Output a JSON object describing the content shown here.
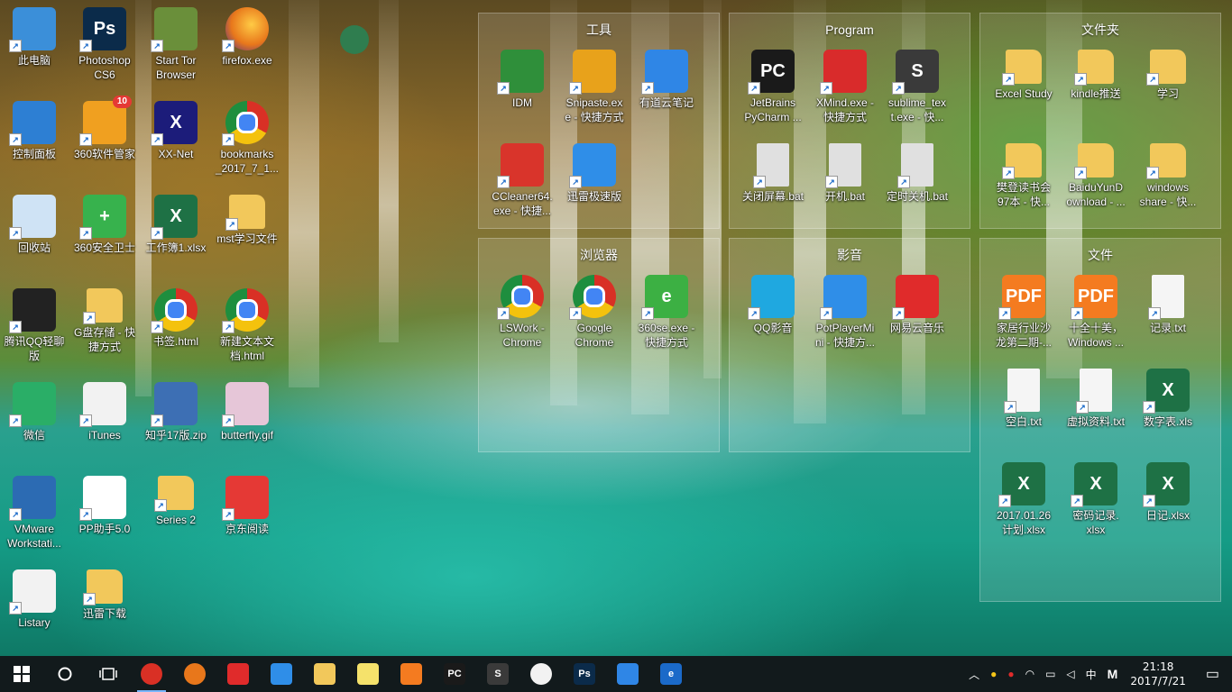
{
  "desktop_icons": [
    {
      "label": "此电脑",
      "icon": "computer-icon",
      "color": "#3b8fd9"
    },
    {
      "label": "Photoshop\nCS6",
      "icon": "photoshop-icon",
      "color": "#0b2b4a",
      "text": "Ps"
    },
    {
      "label": "Start Tor\nBrowser",
      "icon": "tor-icon",
      "color": "#6a8f3a"
    },
    {
      "label": "firefox.exe",
      "icon": "firefox-icon",
      "color": "#e8771b"
    },
    {
      "label": "控制面板",
      "icon": "control-panel-icon",
      "color": "#2d7fd3"
    },
    {
      "label": "360软件管家",
      "icon": "360-manager-icon",
      "color": "#f0a020",
      "badge": "10"
    },
    {
      "label": "XX-Net",
      "icon": "xxnet-icon",
      "color": "#1c1c7a",
      "text": "X"
    },
    {
      "label": "bookmarks\n_2017_7_1...",
      "icon": "chrome-icon",
      "color": "#d93025"
    },
    {
      "label": "回收站",
      "icon": "recycle-bin-icon",
      "color": "#cfe3f5"
    },
    {
      "label": "360安全卫士",
      "icon": "360-safe-icon",
      "color": "#37b24d",
      "text": "+"
    },
    {
      "label": "工作簿1.xlsx",
      "icon": "excel-icon",
      "color": "#1e7145",
      "text": "X"
    },
    {
      "label": "mst学习文件",
      "icon": "folder-icon",
      "color": "#f2c85b"
    },
    {
      "label": "腾讯QQ轻聊\n版",
      "icon": "qq-icon",
      "color": "#222"
    },
    {
      "label": "G盘存储 - 快\n捷方式",
      "icon": "folder-icon",
      "color": "#f2c85b"
    },
    {
      "label": "书签.html",
      "icon": "chrome-icon",
      "color": "#d93025"
    },
    {
      "label": "新建文本文\n档.html",
      "icon": "chrome-icon",
      "color": "#d93025"
    },
    {
      "label": "微信",
      "icon": "wechat-icon",
      "color": "#2aae67"
    },
    {
      "label": "iTunes",
      "icon": "itunes-icon",
      "color": "#f2f2f2"
    },
    {
      "label": "知乎17版.zip",
      "icon": "zip-icon",
      "color": "#3d6fb4"
    },
    {
      "label": "butterfly.gif",
      "icon": "gif-icon",
      "color": "#e6c6d8"
    },
    {
      "label": "VMware\nWorkstati...",
      "icon": "vmware-icon",
      "color": "#2c6bb3"
    },
    {
      "label": "PP助手5.0",
      "icon": "pp-icon",
      "color": "#ffffff",
      "text": "P"
    },
    {
      "label": "Series 2",
      "icon": "folder-icon",
      "color": "#f2c85b"
    },
    {
      "label": "京东阅读",
      "icon": "jd-read-icon",
      "color": "#e53935"
    },
    {
      "label": "Listary",
      "icon": "listary-icon",
      "color": "#f2f2f2"
    },
    {
      "label": "迅雷下载",
      "icon": "folder-icon",
      "color": "#f2c85b"
    }
  ],
  "globe_icon": {
    "icon": "globe-icon",
    "color": "#2f7d4f"
  },
  "fences": [
    {
      "title": "工具",
      "items": [
        {
          "label": "IDM",
          "icon": "idm-icon",
          "color": "#2f8f3a"
        },
        {
          "label": "Snipaste.ex\ne - 快捷方式",
          "icon": "snipaste-icon",
          "color": "#e8a21b"
        },
        {
          "label": "有道云笔记",
          "icon": "youdao-note-icon",
          "color": "#2f86e6"
        },
        {
          "label": "CCleaner64.\nexe - 快捷...",
          "icon": "ccleaner-icon",
          "color": "#d9342b"
        },
        {
          "label": "迅雷极速版",
          "icon": "xunlei-icon",
          "color": "#2f8ee8"
        }
      ]
    },
    {
      "title": "Program",
      "items": [
        {
          "label": "JetBrains\nPyCharm ...",
          "icon": "pycharm-icon",
          "color": "#1a1a1a",
          "text": "PC"
        },
        {
          "label": "XMind.exe -\n快捷方式",
          "icon": "xmind-icon",
          "color": "#d92b2b"
        },
        {
          "label": "sublime_tex\nt.exe - 快...",
          "icon": "sublime-icon",
          "color": "#3a3a3a",
          "text": "S"
        },
        {
          "label": "关闭屏幕.bat",
          "icon": "bat-icon",
          "color": "#e0e0e0"
        },
        {
          "label": "开机.bat",
          "icon": "bat-icon",
          "color": "#e0e0e0"
        },
        {
          "label": "定时关机.bat",
          "icon": "bat-icon",
          "color": "#e0e0e0"
        }
      ]
    },
    {
      "title": "文件夹",
      "items": [
        {
          "label": "Excel Study",
          "icon": "folder-icon",
          "color": "#f2c85b"
        },
        {
          "label": "kindle推送",
          "icon": "folder-icon",
          "color": "#f2c85b"
        },
        {
          "label": "学习",
          "icon": "folder-icon",
          "color": "#f2c85b"
        },
        {
          "label": "樊登读书会\n97本 - 快...",
          "icon": "folder-icon",
          "color": "#f2c85b"
        },
        {
          "label": "BaiduYunD\nownload - ...",
          "icon": "folder-icon",
          "color": "#f2c85b"
        },
        {
          "label": "windows\nshare - 快...",
          "icon": "folder-icon",
          "color": "#f2c85b"
        }
      ]
    },
    {
      "title": "浏览器",
      "items": [
        {
          "label": "LSWork -\nChrome",
          "icon": "chrome-icon",
          "color": "#d93025"
        },
        {
          "label": "Google\nChrome",
          "icon": "chrome-icon",
          "color": "#d93025"
        },
        {
          "label": "360se.exe -\n快捷方式",
          "icon": "360se-icon",
          "color": "#3cb043",
          "text": "e"
        }
      ]
    },
    {
      "title": "影音",
      "items": [
        {
          "label": "QQ影音",
          "icon": "qqplayer-icon",
          "color": "#1fa8e0"
        },
        {
          "label": "PotPlayerMi\nni - 快捷方...",
          "icon": "potplayer-icon",
          "color": "#2f8ee8"
        },
        {
          "label": "网易云音乐",
          "icon": "netease-music-icon",
          "color": "#e02b2b"
        }
      ]
    },
    {
      "title": "文件",
      "items": [
        {
          "label": "家居行业沙\n龙第二期-...",
          "icon": "pdf-icon",
          "color": "#f47b20",
          "text": "PDF"
        },
        {
          "label": "十全十美，\nWindows ...",
          "icon": "pdf-icon",
          "color": "#f47b20",
          "text": "PDF"
        },
        {
          "label": "记录.txt",
          "icon": "txt-icon",
          "color": "#f5f5f5"
        },
        {
          "label": "空白.txt",
          "icon": "txt-icon",
          "color": "#f5f5f5"
        },
        {
          "label": "虚拟资料.txt",
          "icon": "txt-icon",
          "color": "#f5f5f5"
        },
        {
          "label": "数字表.xls",
          "icon": "excel-icon",
          "color": "#1e7145",
          "text": "X"
        },
        {
          "label": "2017.01.26\n计划.xlsx",
          "icon": "excel-icon",
          "color": "#1e7145",
          "text": "X"
        },
        {
          "label": "密码记录.\nxlsx",
          "icon": "excel-icon",
          "color": "#1e7145",
          "text": "X"
        },
        {
          "label": "日记.xlsx",
          "icon": "excel-icon",
          "color": "#1e7145",
          "text": "X"
        }
      ]
    }
  ],
  "taskbar": {
    "apps": [
      {
        "icon": "chrome-icon",
        "color": "#d93025",
        "active": true
      },
      {
        "icon": "firefox-icon",
        "color": "#e8771b",
        "active": false
      },
      {
        "icon": "netease-music-icon",
        "color": "#e02b2b",
        "active": false
      },
      {
        "icon": "potplayer-icon",
        "color": "#2f8ee8",
        "active": false
      },
      {
        "icon": "file-explorer-icon",
        "color": "#f2c85b",
        "active": false
      },
      {
        "icon": "sticky-notes-icon",
        "color": "#f5e26b",
        "active": false
      },
      {
        "icon": "pdf-icon",
        "color": "#f47b20",
        "active": false
      },
      {
        "icon": "pycharm-icon",
        "color": "#1a1a1a",
        "text": "PC",
        "active": false
      },
      {
        "icon": "sublime-icon",
        "color": "#3a3a3a",
        "text": "S",
        "active": false
      },
      {
        "icon": "alarm-icon",
        "color": "#f2f2f2",
        "active": false
      },
      {
        "icon": "photoshop-icon",
        "color": "#0b2b4a",
        "text": "Ps",
        "active": false
      },
      {
        "icon": "baidu-netdisk-icon",
        "color": "#2f86e6",
        "active": false
      },
      {
        "icon": "edge-icon",
        "color": "#1b6ac9",
        "text": "e",
        "active": false
      }
    ],
    "tray_ime": "中",
    "tray_m": "M",
    "time": "21:18",
    "date": "2017/7/21"
  }
}
